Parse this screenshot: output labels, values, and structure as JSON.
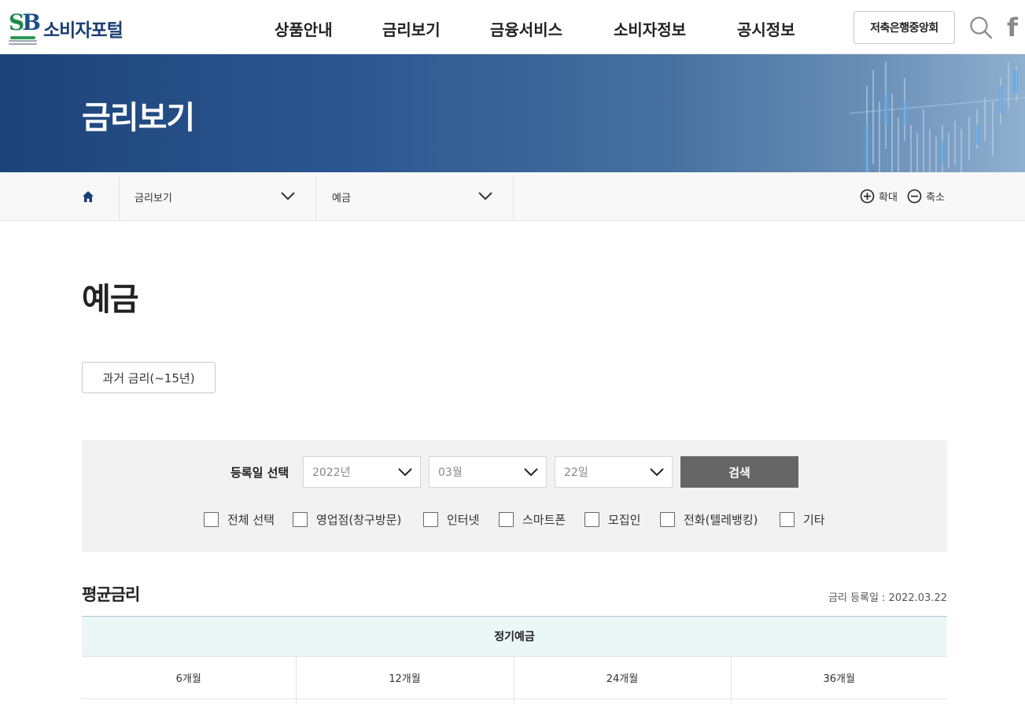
{
  "header": {
    "logo_name": "소비자포털",
    "logo_mark": "SB",
    "nav": [
      "상품안내",
      "금리보기",
      "금융서비스",
      "소비자정보",
      "공시정보"
    ],
    "assoc_button": "저축은행중앙회",
    "icons": {
      "search": "search-icon",
      "facebook": "facebook-icon"
    },
    "facebook_glyph": "f"
  },
  "banner": {
    "title": "금리보기"
  },
  "location": {
    "home_icon": "home-icon",
    "level1": "금리보기",
    "level2": "예금",
    "zoom_in": "확대",
    "zoom_out": "축소"
  },
  "page": {
    "title": "예금",
    "past_rates_button": "과거 금리(~15년)"
  },
  "filter": {
    "label": "등록일 선택",
    "year": "2022년",
    "month": "03월",
    "day": "22일",
    "search_button": "검색",
    "channels": [
      "전체 선택",
      "영업점(창구방문)",
      "인터넷",
      "스마트폰",
      "모집인",
      "전화(텔레뱅킹)",
      "기타"
    ]
  },
  "average": {
    "title": "평균금리",
    "date_text": "금리 등록일 : 2022.03.22",
    "table_header": "정기예금",
    "periods": [
      "6개월",
      "12개월",
      "24개월",
      "36개월"
    ]
  },
  "colors": {
    "brand_navy": "#1b3f73",
    "brand_green": "#1f8a4c",
    "banner_start": "#1c447a",
    "banner_end": "#8fb0cf",
    "search_button": "#666666",
    "table_header_bg": "#ebf6f7"
  }
}
